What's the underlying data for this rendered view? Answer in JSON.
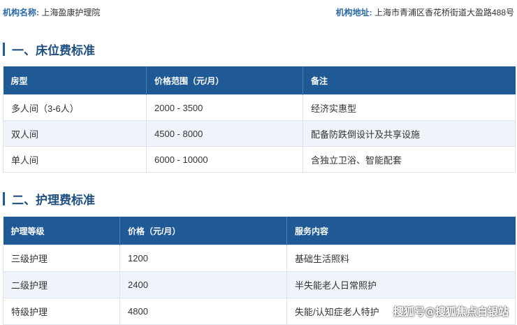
{
  "org": {
    "name_label": "机构名称:",
    "name_value": "上海盈康护理院",
    "address_label": "机构地址:",
    "address_value": "上海市青浦区香花桥街道大盈路488号"
  },
  "sections": {
    "room": {
      "title": "一、床位费标准"
    },
    "care": {
      "title": "二、护理费标准"
    }
  },
  "room_table": {
    "headers": [
      "房型",
      "价格范围（元/月）",
      "备注"
    ],
    "rows": [
      [
        "多人间（3-6人）",
        "2000 - 3500",
        "经济实惠型"
      ],
      [
        "双人间",
        "4500 - 8000",
        "配备防跌倒设计及共享设施"
      ],
      [
        "单人间",
        "6000 - 10000",
        "含独立卫浴、智能配套"
      ]
    ]
  },
  "care_table": {
    "headers": [
      "护理等级",
      "价格（元/月）",
      "服务内容"
    ],
    "rows": [
      [
        "三级护理",
        "1200",
        "基础生活照料"
      ],
      [
        "二级护理",
        "2400",
        "半失能老人日常照护"
      ],
      [
        "特级护理",
        "4800",
        "失能/认知症老人特护"
      ]
    ]
  },
  "watermark": "搜狐号@搜狐焦点白银站",
  "colors": {
    "header_bg": "#1f5a96",
    "accent_text": "#2a6aa8",
    "stripe": "#eef4fa"
  }
}
